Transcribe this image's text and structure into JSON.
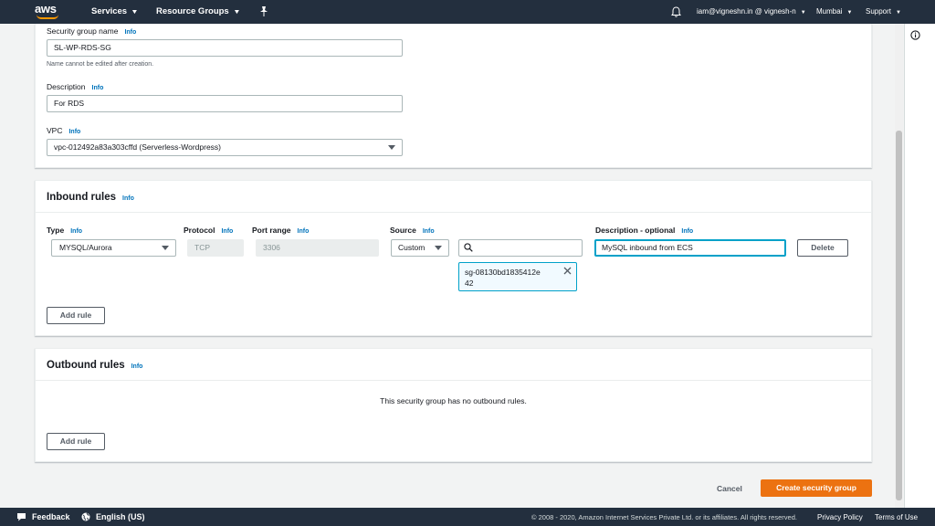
{
  "nav": {
    "logo": "aws",
    "services": "Services",
    "resource_groups": "Resource Groups",
    "account": "iam@vigneshn.in @ vignesh-n",
    "region": "Mumbai",
    "support": "Support"
  },
  "basic": {
    "sg_name_label": "Security group name",
    "sg_name_info": "Info",
    "sg_name_value": "SL-WP-RDS-SG",
    "sg_name_hint": "Name cannot be edited after creation.",
    "description_label": "Description",
    "description_info": "Info",
    "description_value": "For RDS",
    "vpc_label": "VPC",
    "vpc_info": "Info",
    "vpc_value": "vpc-012492a83a303cffd (Serverless-Wordpress)"
  },
  "inbound": {
    "title": "Inbound rules",
    "title_info": "Info",
    "columns": {
      "type": "Type",
      "type_info": "Info",
      "protocol": "Protocol",
      "protocol_info": "Info",
      "port_range": "Port range",
      "port_range_info": "Info",
      "source": "Source",
      "source_info": "Info",
      "description": "Description - optional",
      "description_info": "Info"
    },
    "rule": {
      "type": "MYSQL/Aurora",
      "protocol": "TCP",
      "port_range": "3306",
      "source": "Custom",
      "source_search": "",
      "source_token_line1": "sg-08130bd1835412e",
      "source_token_line2": "42",
      "description": "MySQL inbound from ECS",
      "delete": "Delete"
    },
    "add_rule": "Add rule"
  },
  "outbound": {
    "title": "Outbound rules",
    "title_info": "Info",
    "empty_message": "This security group has no outbound rules.",
    "add_rule": "Add rule"
  },
  "actions": {
    "cancel": "Cancel",
    "create": "Create security group"
  },
  "footer": {
    "feedback": "Feedback",
    "language": "English (US)",
    "copyright": "© 2008 - 2020, Amazon Internet Services Private Ltd. or its affiliates. All rights reserved.",
    "privacy": "Privacy Policy",
    "terms": "Terms of Use"
  },
  "colors": {
    "nav_bg": "#232f3e",
    "accent_orange": "#ec7211",
    "info_link": "#0073bb",
    "focus_border": "#00a1c9"
  }
}
